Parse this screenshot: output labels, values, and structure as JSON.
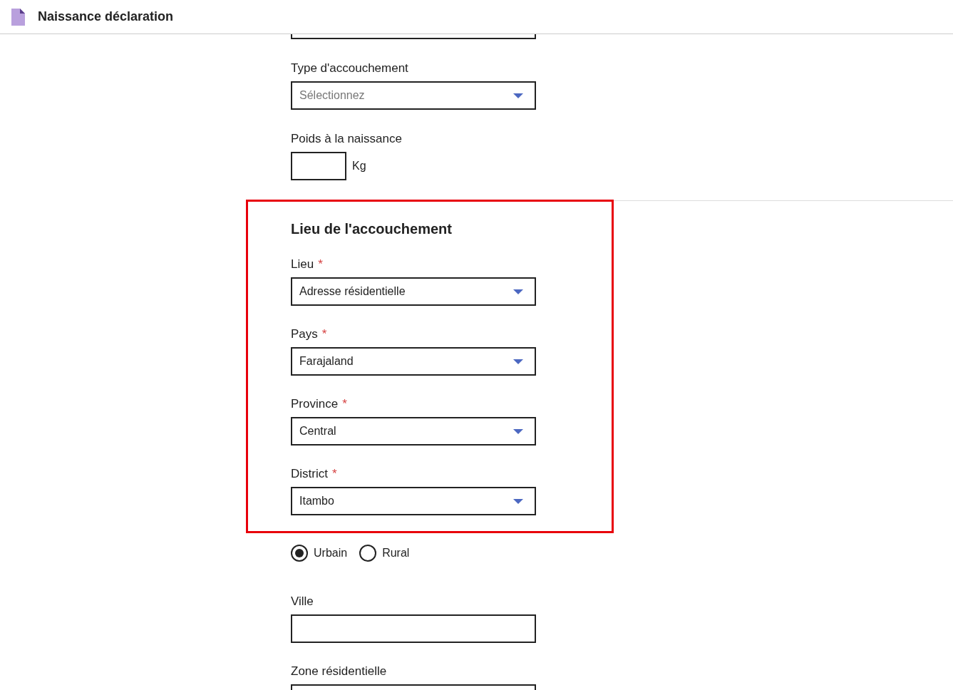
{
  "header": {
    "title": "Naissance déclaration"
  },
  "required_mark": "*",
  "fields_top": [
    {
      "kind": "cut"
    },
    {
      "kind": "select",
      "label": "Type d'accouchement",
      "placeholder": "Sélectionnez"
    },
    {
      "kind": "unit",
      "label": "Poids à la naissance",
      "unit": "Kg"
    }
  ],
  "section": {
    "title": "Lieu de l'accouchement",
    "highlighted": true,
    "fields": [
      {
        "label": "Lieu",
        "required": true,
        "value": "Adresse résidentielle"
      },
      {
        "label": "Pays",
        "required": true,
        "value": "Farajaland"
      },
      {
        "label": "Province",
        "required": true,
        "value": "Central"
      },
      {
        "label": "District",
        "required": true,
        "value": "Itambo"
      }
    ]
  },
  "radios": [
    {
      "label": "Urbain",
      "selected": true
    },
    {
      "label": "Rural",
      "selected": false
    }
  ],
  "fields_bottom": [
    {
      "label": "Ville"
    },
    {
      "label": "Zone résidentielle"
    }
  ]
}
